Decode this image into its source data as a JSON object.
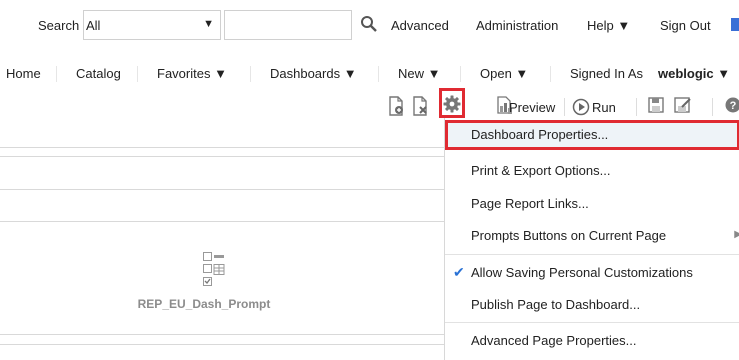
{
  "top": {
    "search_label": "Search",
    "search_scope": "All",
    "search_value": "",
    "advanced": "Advanced",
    "administration": "Administration",
    "help": "Help ▼",
    "sign_out": "Sign Out"
  },
  "nav": {
    "home": "Home",
    "catalog": "Catalog",
    "favorites": "Favorites ▼",
    "dashboards": "Dashboards ▼",
    "new": "New ▼",
    "open": "Open ▼",
    "signed_in_prefix": "Signed In As",
    "signed_in_user": "weblogic ▼"
  },
  "toolbar": {
    "preview": "Preview",
    "run": "Run"
  },
  "canvas": {
    "prompt_label": "REP_EU_Dash_Prompt"
  },
  "menu": {
    "items": [
      {
        "label": "Dashboard Properties..."
      },
      {
        "label": "Print & Export Options..."
      },
      {
        "label": "Page Report Links..."
      },
      {
        "label": "Prompts Buttons on Current Page"
      },
      {
        "label": "Allow Saving Personal Customizations"
      },
      {
        "label": "Publish Page to Dashboard..."
      },
      {
        "label": "Advanced Page Properties..."
      }
    ]
  },
  "colors": {
    "highlight_border": "#e02a32",
    "check": "#2a72d5",
    "accent": "#3a6fd6"
  },
  "icons": [
    "search-icon",
    "add-section-icon",
    "delete-section-icon",
    "gear-icon",
    "preview-icon",
    "run-icon",
    "save-icon",
    "save-as-icon",
    "help-icon",
    "checkmark-icon",
    "submenu-arrow-icon",
    "prompt-icon"
  ]
}
